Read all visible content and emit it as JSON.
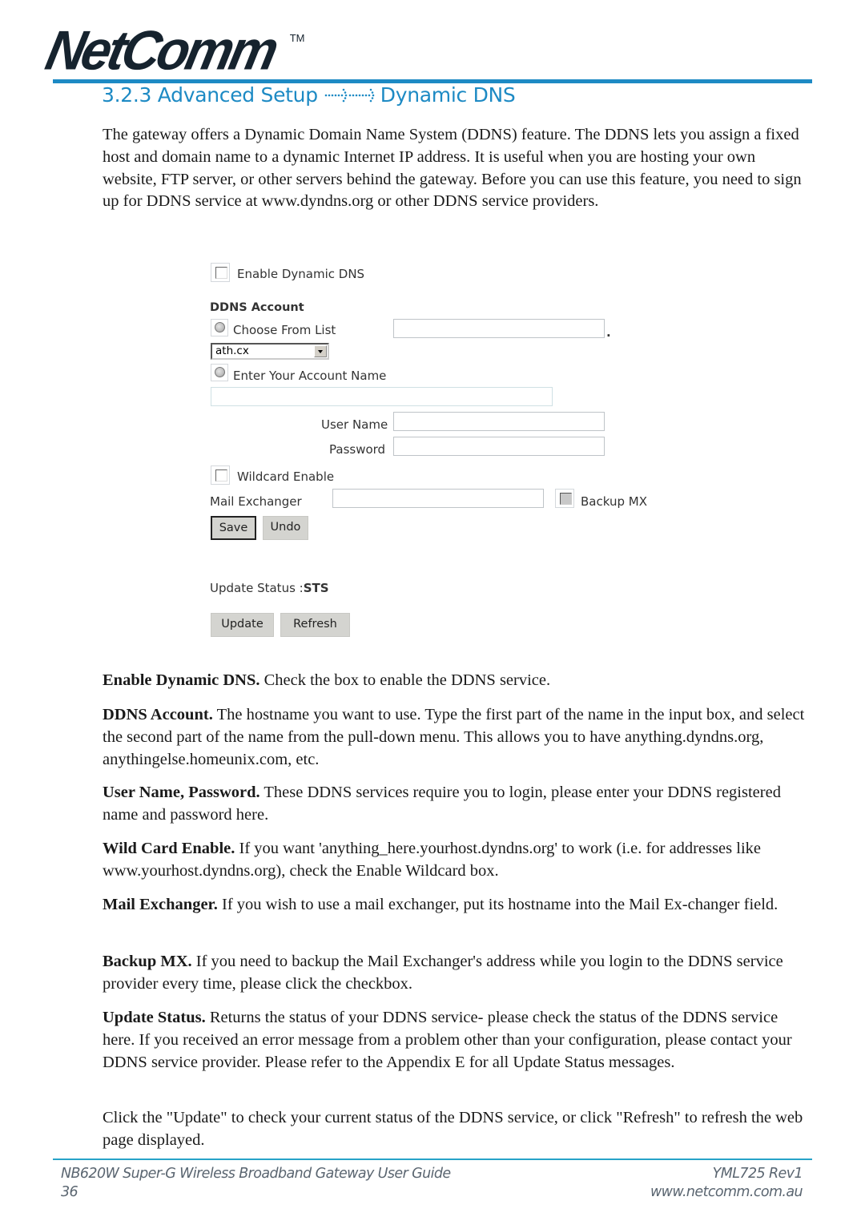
{
  "brand": {
    "logo": "NetComm",
    "trademark": "TM"
  },
  "section": {
    "number": "3.2.3",
    "crumb": "Advanced Setup",
    "separator_icon": "dotted-arrow-icon",
    "page": "Dynamic DNS",
    "accent_color": "#1d8ac4"
  },
  "intro": "The gateway offers a Dynamic Domain Name System (DDNS) feature. The DDNS lets you assign a fixed host and domain name to a dynamic Internet IP address. It is useful when you are hosting your own website, FTP server, or other servers behind the gateway. Before you can use this feature, you need to sign up for DDNS service at www.dyndns.org or other DDNS service providers.",
  "form": {
    "enable_ddns": {
      "label": "Enable Dynamic DNS",
      "checked": false
    },
    "account_heading": "DDNS Account",
    "choose_from_list": {
      "label": "Choose From List",
      "hostname_value": "",
      "dot": "."
    },
    "domain_select": {
      "value": "ath.cx"
    },
    "enter_account": {
      "label": "Enter Your Account Name",
      "value": ""
    },
    "user_name": {
      "label": "User Name",
      "value": ""
    },
    "password": {
      "label": "Password",
      "value": ""
    },
    "wildcard": {
      "label": "Wildcard Enable",
      "checked": false
    },
    "mail_exchanger": {
      "label": "Mail Exchanger",
      "value": ""
    },
    "backup_mx": {
      "label": "Backup MX",
      "checked": false
    },
    "save_label": "Save",
    "undo_label": "Undo",
    "update_status_label": "Update Status :",
    "update_status_value": "STS",
    "update_label": "Update",
    "refresh_label": "Refresh"
  },
  "descriptions": [
    {
      "term": "Enable Dynamic DNS.",
      "text": " Check the box to enable the DDNS service."
    },
    {
      "term": "DDNS Account.",
      "text": " The hostname you want to use. Type the first part of the name in the input box, and select the second part of the name from the pull-down menu. This allows you to have anything.dyndns.org, anythingelse.homeunix.com, etc."
    },
    {
      "term": "User Name, Password.",
      "text": " These DDNS services require you to login, please enter your DDNS registered name and password here."
    },
    {
      "term": "Wild Card Enable.",
      "text": " If you want 'anything_here.yourhost.dyndns.org' to work (i.e. for addresses like www.yourhost.dyndns.org), check the Enable Wildcard box."
    },
    {
      "term": "Mail Exchanger.",
      "text": " If you wish to use a mail exchanger, put its hostname into the Mail Ex-changer field."
    },
    {
      "term": "Backup MX.",
      "text": " If you need to backup the Mail Exchanger's address while you login to the DDNS service provider every time, please click the checkbox."
    },
    {
      "term": "Update Status.",
      "text": " Returns the status of your DDNS service- please check the status of the DDNS service here. If you received an error message from a problem other than your configuration, please contact your DDNS service provider. Please refer to the Appendix E for all Update Status messages."
    },
    {
      "term": "",
      "text": "Click the \"Update\" to check your current status of the DDNS service, or click \"Refresh\" to refresh the web page displayed."
    }
  ],
  "footer": {
    "guide_title": "NB620W Super-G Wireless Broadband  Gateway User Guide",
    "page_number": "36",
    "doc_code": "YML725 Rev1",
    "website": "www.netcomm.com.au"
  }
}
